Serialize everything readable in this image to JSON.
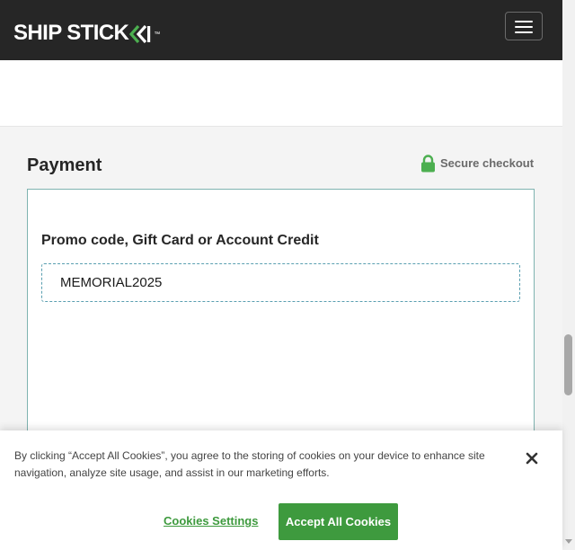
{
  "header": {
    "logo_text": "SHIP STICK",
    "logo_trademark": "™",
    "menu_icon": "hamburger-menu-icon"
  },
  "payment": {
    "title": "Payment",
    "secure_label": "Secure checkout",
    "secure_icon": "lock-icon",
    "promo_label": "Promo code, Gift Card or Account Credit",
    "promo_value": "MEMORIAL2025"
  },
  "cookie_banner": {
    "text": "By clicking “Accept All Cookies”, you agree to the storing of cookies on your device to enhance site navigation, analyze site usage, and assist in our marketing efforts.",
    "settings_label": "Cookies Settings",
    "accept_label": "Accept All Cookies",
    "close_icon": "close-icon"
  },
  "colors": {
    "header_bg": "#262626",
    "accent_green": "#3e9a3e",
    "lock_green": "#4caf50",
    "page_bg": "#f4f4f4",
    "card_border": "#7fb3b0"
  }
}
